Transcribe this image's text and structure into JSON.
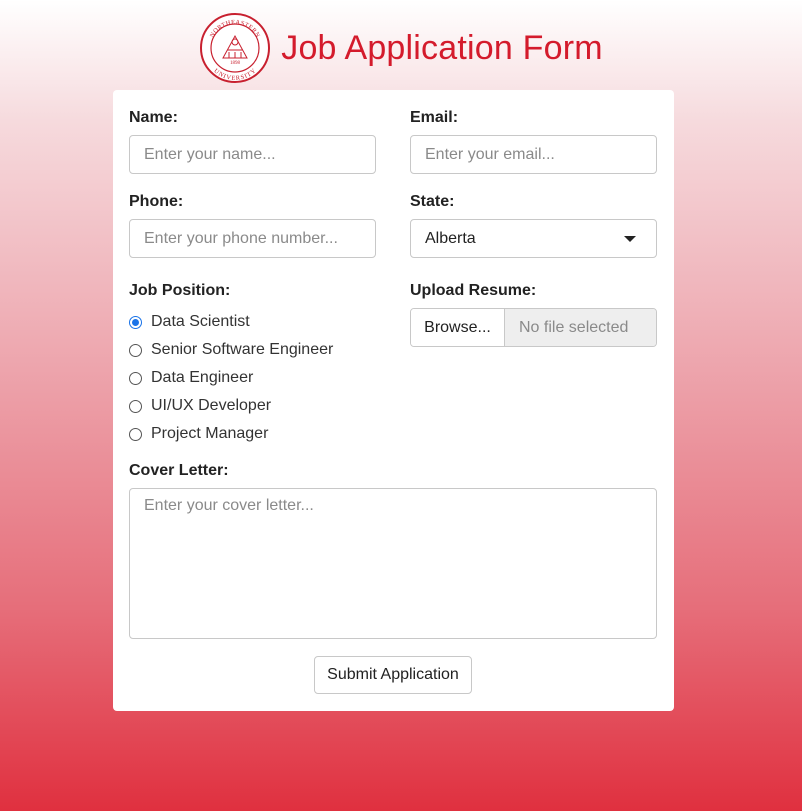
{
  "header": {
    "title": "Job Application Form",
    "logo_icon": "northeastern-university-seal-icon",
    "logo_text_top": "NORTHEASTERN",
    "logo_text_bottom": "UNIVERSITY",
    "logo_year": "1898"
  },
  "colors": {
    "accent": "#d41b2c",
    "radio_checked": "#1a73e8"
  },
  "form": {
    "name": {
      "label": "Name:",
      "placeholder": "Enter your name...",
      "value": ""
    },
    "email": {
      "label": "Email:",
      "placeholder": "Enter your email...",
      "value": ""
    },
    "phone": {
      "label": "Phone:",
      "placeholder": "Enter your phone number...",
      "value": ""
    },
    "state": {
      "label": "State:",
      "selected": "Alberta",
      "icon": "caret-down-icon"
    },
    "job_position": {
      "label": "Job Position:",
      "options": [
        {
          "label": "Data Scientist",
          "checked": true
        },
        {
          "label": "Senior Software Engineer",
          "checked": false
        },
        {
          "label": "Data Engineer",
          "checked": false
        },
        {
          "label": "UI/UX Developer",
          "checked": false
        },
        {
          "label": "Project Manager",
          "checked": false
        }
      ]
    },
    "resume": {
      "label": "Upload Resume:",
      "browse_label": "Browse...",
      "status": "No file selected"
    },
    "cover_letter": {
      "label": "Cover Letter:",
      "placeholder": "Enter your cover letter...",
      "value": ""
    },
    "submit_label": "Submit Application"
  }
}
